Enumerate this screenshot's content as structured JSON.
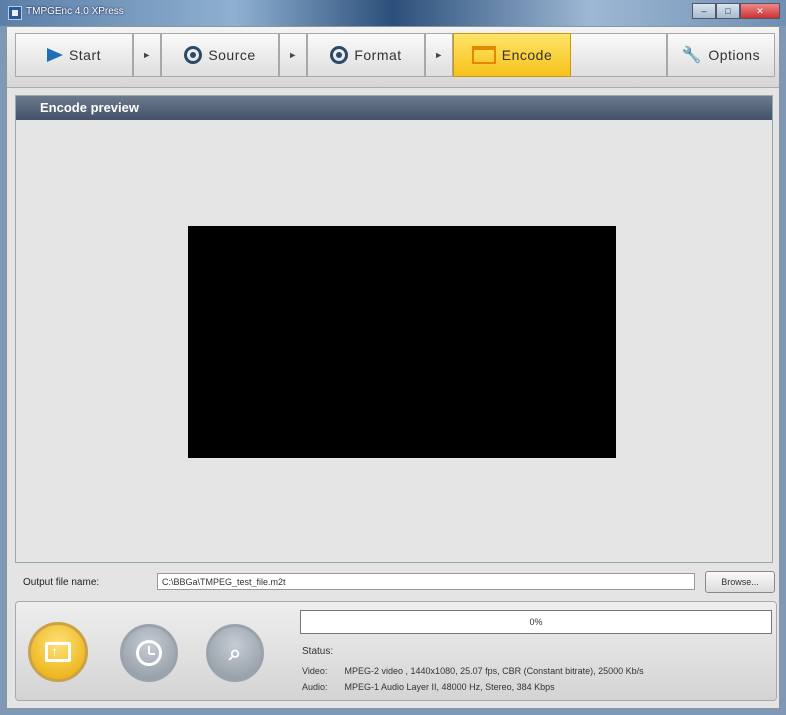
{
  "window": {
    "title": "TMPGEnc 4.0 XPress"
  },
  "toolbar": {
    "start": "Start",
    "source": "Source",
    "format": "Format",
    "encode": "Encode",
    "options": "Options",
    "active_tab": "Encode",
    "accent_color": "#f7c21a"
  },
  "preview": {
    "header": "Encode preview"
  },
  "output": {
    "label": "Output file name:",
    "value": "C:\\BBGa\\TMPEG_test_file.m2t",
    "browse": "Browse..."
  },
  "progress": {
    "value": 0,
    "text": "0%"
  },
  "status": {
    "label": "Status:",
    "video_label": "Video:",
    "video_value": "MPEG-2 video , 1440x1080, 25.07 fps, CBR (Constant bitrate), 25000 Kb/s",
    "audio_label": "Audio:",
    "audio_value": "MPEG-1 Audio Layer II, 48000 Hz, Stereo, 384 Kbps"
  },
  "icons": {
    "start": "play-icon",
    "source": "film-reel-icon",
    "format": "film-reel-icon",
    "encode": "encode-frame-icon",
    "options": "wrench-icon"
  }
}
